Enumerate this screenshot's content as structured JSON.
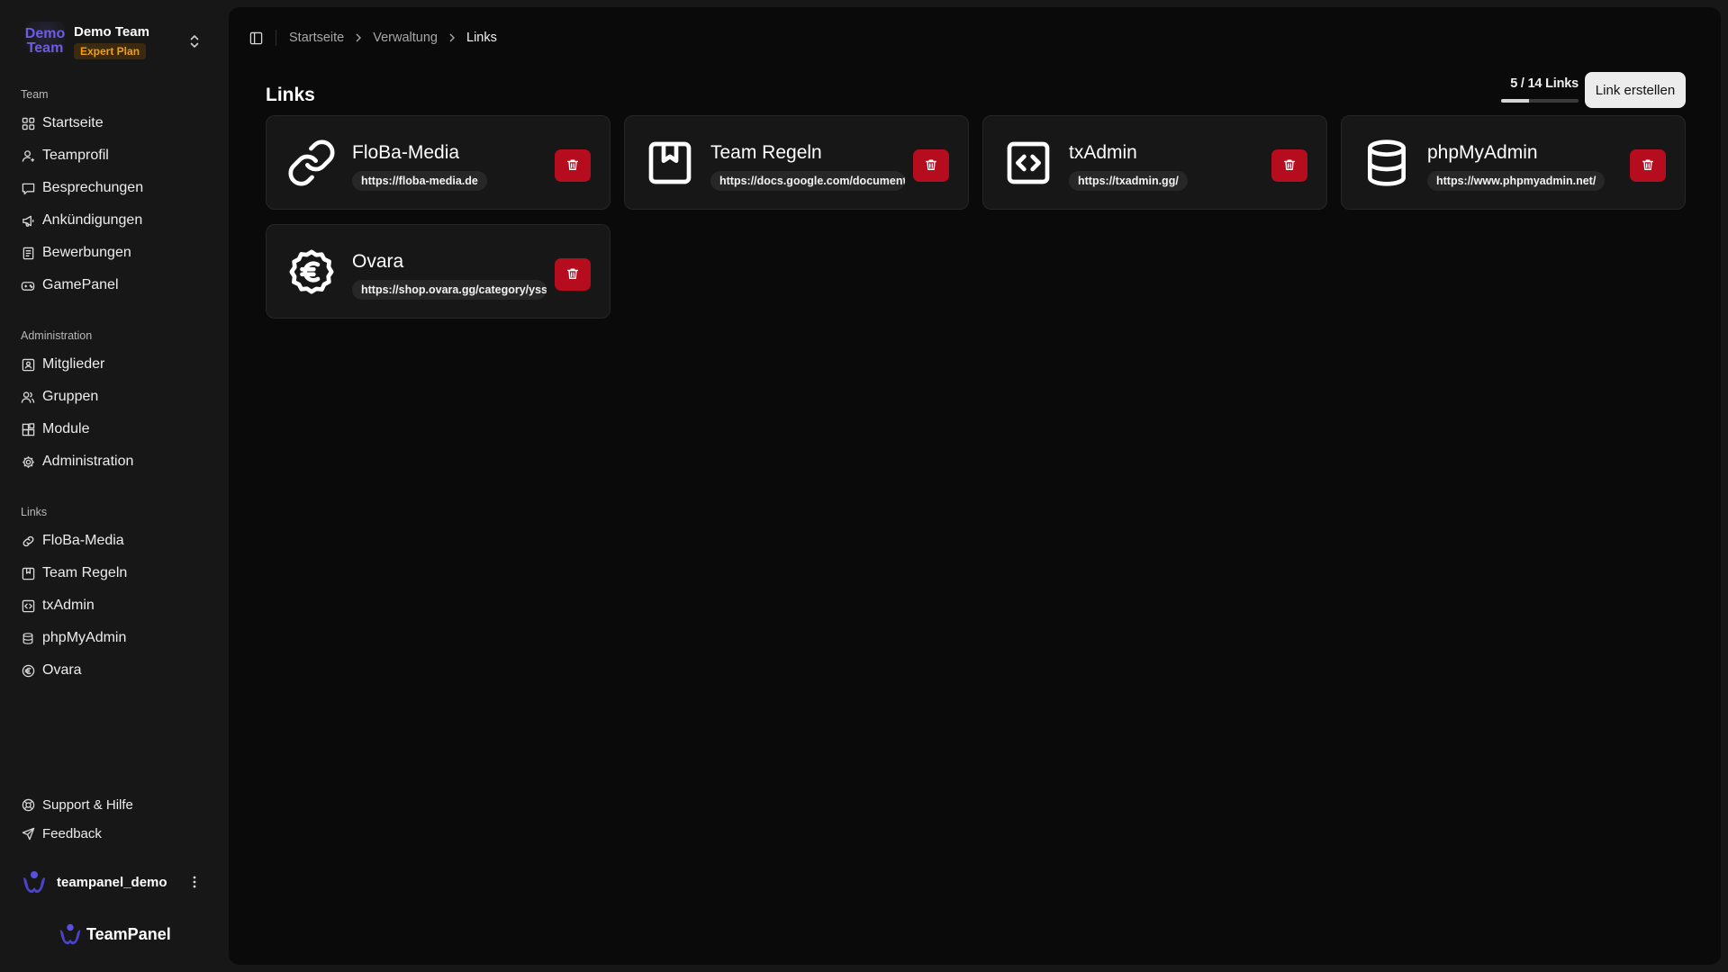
{
  "team": {
    "logo_line1": "Demo",
    "logo_line2": "Team",
    "name": "Demo Team",
    "plan": "Expert Plan"
  },
  "sidebar": {
    "team_section": {
      "label": "Team",
      "items": [
        {
          "label": "Startseite",
          "icon": "layout-grid-icon"
        },
        {
          "label": "Teamprofil",
          "icon": "user-profile-icon"
        },
        {
          "label": "Besprechungen",
          "icon": "message-square-icon"
        },
        {
          "label": "Ankündigungen",
          "icon": "megaphone-icon"
        },
        {
          "label": "Bewerbungen",
          "icon": "file-list-icon"
        },
        {
          "label": "GamePanel",
          "icon": "gamepad-icon"
        }
      ]
    },
    "admin_section": {
      "label": "Administration",
      "items": [
        {
          "label": "Mitglieder",
          "icon": "contact-card-icon"
        },
        {
          "label": "Gruppen",
          "icon": "users-icon"
        },
        {
          "label": "Module",
          "icon": "blocks-icon"
        },
        {
          "label": "Administration",
          "icon": "gear-icon"
        }
      ]
    },
    "links_section": {
      "label": "Links",
      "items": [
        {
          "label": "FloBa-Media",
          "icon": "link-icon"
        },
        {
          "label": "Team Regeln",
          "icon": "bookmark-icon"
        },
        {
          "label": "txAdmin",
          "icon": "code-icon"
        },
        {
          "label": "phpMyAdmin",
          "icon": "database-icon"
        },
        {
          "label": "Ovara",
          "icon": "euro-icon"
        }
      ]
    },
    "footer_items": [
      {
        "label": "Support & Hilfe",
        "icon": "lifebuoy-icon"
      },
      {
        "label": "Feedback",
        "icon": "send-icon"
      }
    ],
    "user": {
      "name": "teampanel_demo"
    },
    "brand": "TeamPanel"
  },
  "breadcrumb": {
    "items": [
      "Startseite",
      "Verwaltung",
      "Links"
    ]
  },
  "page": {
    "title": "Links",
    "usage_text": "5 / 14 Links",
    "usage_fraction": 0.357,
    "create_button": "Link erstellen"
  },
  "links": [
    {
      "title": "FloBa-Media",
      "url": "https://floba-media.de",
      "icon": "link-icon"
    },
    {
      "title": "Team Regeln",
      "url": "https://docs.google.com/document",
      "icon": "bookmark-icon"
    },
    {
      "title": "txAdmin",
      "url": "https://txadmin.gg/",
      "icon": "code-icon"
    },
    {
      "title": "phpMyAdmin",
      "url": "https://www.phpmyadmin.net/",
      "icon": "database-icon"
    },
    {
      "title": "Ovara",
      "url": "https://shop.ovara.gg/category/yss",
      "icon": "euro-icon"
    }
  ],
  "colors": {
    "delete": "#b50d1e",
    "plan_badge": "#f59e0b",
    "brand_accent": "#6d5ce6"
  }
}
